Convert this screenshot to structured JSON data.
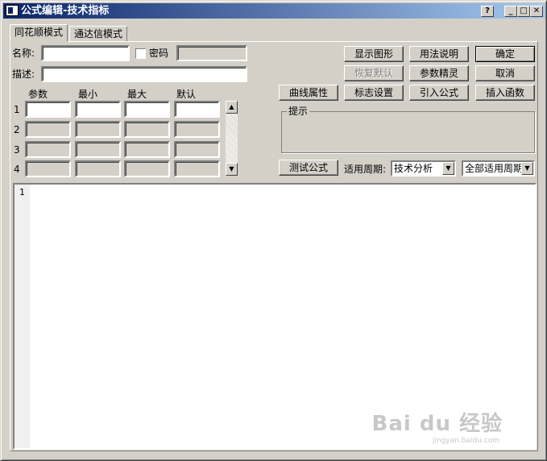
{
  "window": {
    "title": "公式编辑-技术指标",
    "help_label": "?",
    "minimize_label": "_",
    "maximize_label": "□",
    "close_label": "✕"
  },
  "tabs": [
    {
      "label": "同花顺模式",
      "active": true
    },
    {
      "label": "通达信模式",
      "active": false
    }
  ],
  "form": {
    "name_label": "名称:",
    "name_value": "",
    "password_label": "密码",
    "password_checked": false,
    "desc_label": "描述:",
    "desc_value": ""
  },
  "params": {
    "headers": [
      "参数",
      "最小",
      "最大",
      "默认"
    ],
    "rows": [
      {
        "index": "1",
        "name": "",
        "min": "",
        "max": "",
        "default": "",
        "enabled": true
      },
      {
        "index": "2",
        "name": "",
        "min": "",
        "max": "",
        "default": "",
        "enabled": false
      },
      {
        "index": "3",
        "name": "",
        "min": "",
        "max": "",
        "default": "",
        "enabled": false
      },
      {
        "index": "4",
        "name": "",
        "min": "",
        "max": "",
        "default": "",
        "enabled": false
      }
    ],
    "scroll_up": "▲",
    "scroll_down": "▼"
  },
  "buttons": {
    "show_graph": "显示图形",
    "usage": "用法说明",
    "ok": "确定",
    "restore_default": "恢复默认",
    "param_wizard": "参数精灵",
    "cancel": "取消",
    "curve_props": "曲线属性",
    "flag_settings": "标志设置",
    "import_formula": "引入公式",
    "insert_function": "插入函数",
    "test_formula": "测试公式"
  },
  "hint": {
    "legend": "提示",
    "text": ""
  },
  "period": {
    "label": "适用周期:",
    "category_value": "技术分析",
    "period_value": "全部适用周期",
    "arrow": "▼"
  },
  "editor": {
    "line_numbers": [
      "1"
    ],
    "content": ""
  },
  "watermark": {
    "brand": "Bai du 经验",
    "url": "jingyan.baidu.com"
  },
  "colors": {
    "face": "#d4d0c8",
    "title_start": "#0a246a",
    "title_end": "#a6caf0",
    "field": "#ffffff"
  }
}
